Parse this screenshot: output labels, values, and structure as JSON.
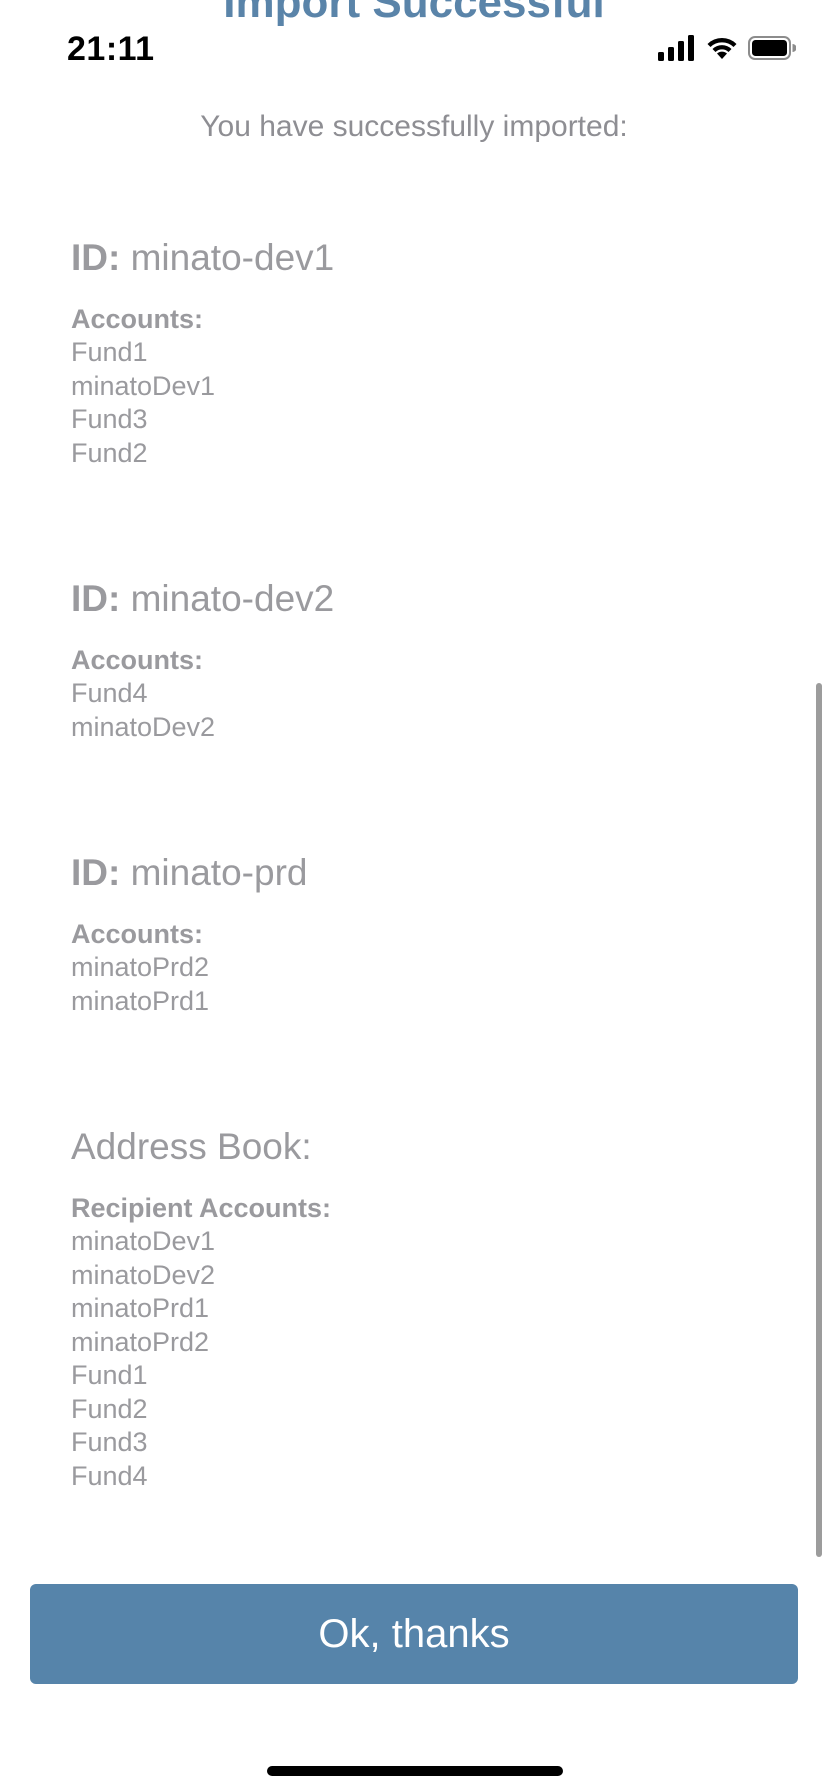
{
  "status_bar": {
    "time": "21:11",
    "icons": [
      "cellular-signal-icon",
      "wifi-icon",
      "battery-icon"
    ]
  },
  "page": {
    "title": "Import Successful",
    "subtitle": "You have successfully imported:"
  },
  "sections": [
    {
      "id_label": "ID:",
      "id_value": "minato-dev1",
      "accounts_label": "Accounts:",
      "accounts": [
        "Fund1",
        "minatoDev1",
        "Fund3",
        "Fund2"
      ]
    },
    {
      "id_label": "ID:",
      "id_value": "minato-dev2",
      "accounts_label": "Accounts:",
      "accounts": [
        "Fund4",
        "minatoDev2"
      ]
    },
    {
      "id_label": "ID:",
      "id_value": "minato-prd",
      "accounts_label": "Accounts:",
      "accounts": [
        "minatoPrd2",
        "minatoPrd1"
      ]
    }
  ],
  "address_book": {
    "title": "Address Book:",
    "accounts_label": "Recipient Accounts:",
    "accounts": [
      "minatoDev1",
      "minatoDev2",
      "minatoPrd1",
      "minatoPrd2",
      "Fund1",
      "Fund2",
      "Fund3",
      "Fund4"
    ]
  },
  "actions": {
    "ok_label": "Ok, thanks"
  },
  "colors": {
    "accent": "#5684aa",
    "muted_text": "#9a9a9e"
  }
}
